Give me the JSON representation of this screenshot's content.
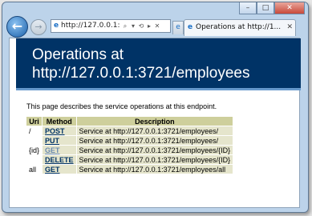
{
  "window_buttons": {
    "minimize": "–",
    "maximize": "□",
    "close": "✕"
  },
  "nav": {
    "back_icon": "←",
    "forward_icon": "→"
  },
  "address_bar": {
    "icon": "e",
    "url": "http://127.0.0.1:",
    "tools": [
      "⌕",
      "▾",
      "⟲",
      "▸",
      "✕"
    ]
  },
  "tabs": {
    "inactive_icon": "e",
    "active": {
      "icon": "e",
      "label": "Operations at http://1...",
      "close": "✕"
    }
  },
  "page": {
    "heading": "Operations at http://127.0.0.1:3721/employees",
    "intro": "This page describes the service operations at this endpoint.",
    "table": {
      "headers": [
        "Uri",
        "Method",
        "Description"
      ],
      "rows": [
        {
          "uri": "/",
          "method": "POST",
          "description": "Service at http://127.0.0.1:3721/employees/"
        },
        {
          "uri": "",
          "method": "PUT",
          "description": "Service at http://127.0.0.1:3721/employees/"
        },
        {
          "uri": "{id}",
          "method": "GET",
          "description": "Service at http://127.0.0.1:3721/employees/{ID}"
        },
        {
          "uri": "",
          "method": "DELETE",
          "description": "Service at http://127.0.0.1:3721/employees/{ID}"
        },
        {
          "uri": "all",
          "method": "GET",
          "description": "Service at http://127.0.0.1:3721/employees/all"
        }
      ]
    }
  }
}
